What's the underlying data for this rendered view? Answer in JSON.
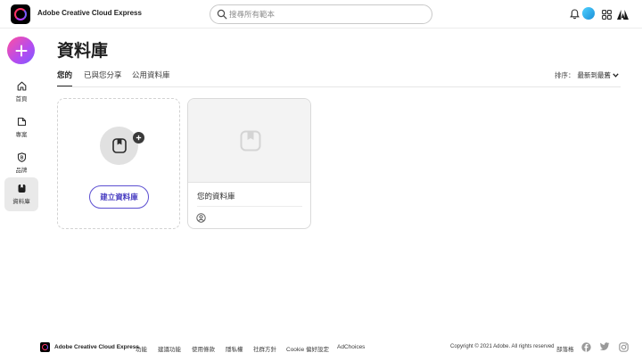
{
  "header": {
    "app_name": "Adobe Creative Cloud Express",
    "search_placeholder": "搜尋所有範本",
    "icons": [
      "bell-icon",
      "avatar",
      "apps-grid-icon",
      "adobe-logo-icon"
    ]
  },
  "sidebar": {
    "create_icon": "plus-icon",
    "items": [
      {
        "label": "首頁",
        "icon": "home-icon",
        "active": false
      },
      {
        "label": "專案",
        "icon": "projects-icon",
        "active": false
      },
      {
        "label": "品牌",
        "icon": "brand-icon",
        "active": false
      },
      {
        "label": "資料庫",
        "icon": "library-icon",
        "active": true
      }
    ]
  },
  "main": {
    "title": "資料庫",
    "tabs": [
      {
        "label": "您的",
        "active": true
      },
      {
        "label": "已與您分享",
        "active": false
      },
      {
        "label": "公用資料庫",
        "active": false
      }
    ],
    "sort": {
      "label": "排序：",
      "value": "最新到最舊"
    },
    "create_card": {
      "button_label": "建立資料庫"
    },
    "libraries": [
      {
        "name": "您的資料庫"
      }
    ]
  },
  "footer": {
    "brand": "Adobe Creative Cloud Express",
    "links": [
      "功能",
      "建議功能",
      "使用條款",
      "隱私權",
      "社群方針",
      "Cookie 偏好設定",
      "AdChoices"
    ],
    "copyright": "Copyright © 2021 Adobe. All rights reserved",
    "blog": "部落格",
    "social": [
      "facebook-icon",
      "twitter-icon",
      "instagram-icon"
    ]
  },
  "colors": {
    "accent": "#5c4fd1",
    "create_gradient_start": "#ff4fa0",
    "create_gradient_end": "#7a5cff"
  }
}
